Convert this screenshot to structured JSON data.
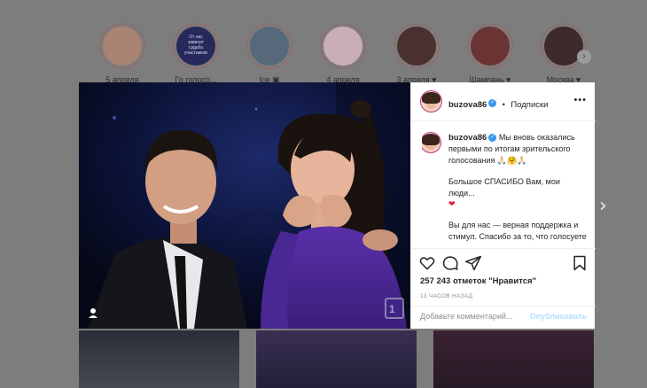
{
  "background": {
    "stories": [
      {
        "label": "5 апреля",
        "color": "#c2a08c"
      },
      {
        "label": "Го голосо...",
        "color": "#2c2f63"
      },
      {
        "label": "Ice ▣",
        "color": "#6a7f8f"
      },
      {
        "label": "4 апреля",
        "color": "#d9c2cb"
      },
      {
        "label": "3 апреля ♥",
        "color": "#5a3a38"
      },
      {
        "label": "Шампань ♥",
        "color": "#7a3a3a"
      },
      {
        "label": "Москва ♥",
        "color": "#4a3030"
      }
    ],
    "story_overlay_lines": [
      "От нас",
      "зависит",
      "судьба",
      "участников"
    ],
    "next_arrow": "›"
  },
  "modal": {
    "next_arrow": "›",
    "photo": {
      "alt": "post photo"
    },
    "header": {
      "username": "buzova86",
      "separator": "•",
      "follow_label": "Подписки",
      "more_label": "•••"
    },
    "caption": {
      "username": "buzova86",
      "line1": "Мы вновь оказались первыми по итогам зрительского голосования 🙏🏻🤗🙏🏻",
      "line2": "Большое СПАСИБО Вам, мои люди...",
      "heart": "❤",
      "line3": "Вы для нас — верная поддержка и стимул. Спасибо за то, что голосуете за нашу пару, переживаете, радуетесь нашим маленьким"
    },
    "actions": {
      "like_icon": "heart-icon",
      "comment_icon": "comment-icon",
      "share_icon": "share-icon",
      "save_icon": "bookmark-icon"
    },
    "likes_text": "257 243 отметок \"Нравится\"",
    "time_ago": "13 ЧАСОВ НАЗАД",
    "comment_placeholder": "Добавьте комментарий...",
    "publish_label": "Опубликовать",
    "colors": {
      "accent": "#3897f0",
      "publish_disabled": "#b2dffc",
      "heart": "#e0203a"
    }
  }
}
